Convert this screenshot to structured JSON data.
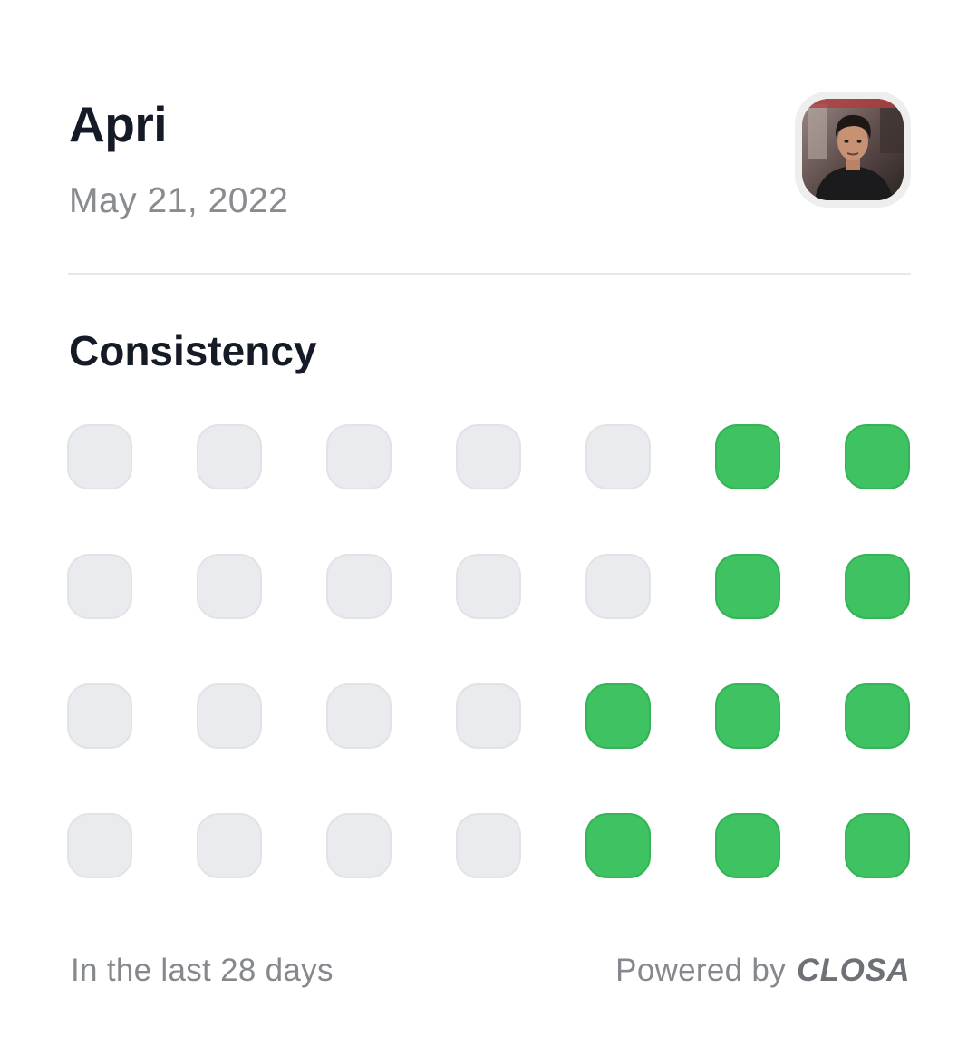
{
  "profile": {
    "name": "Apri",
    "date": "May 21, 2022",
    "avatar_icon": "user-photo"
  },
  "section": {
    "title": "Consistency"
  },
  "consistency": {
    "rows": [
      [
        false,
        false,
        false,
        false,
        false,
        true,
        true
      ],
      [
        false,
        false,
        false,
        false,
        false,
        true,
        true
      ],
      [
        false,
        false,
        false,
        false,
        true,
        true,
        true
      ],
      [
        false,
        false,
        false,
        false,
        true,
        true,
        true
      ]
    ],
    "active_color": "#3fc262",
    "inactive_color": "#eaebee"
  },
  "footer": {
    "period_label": "In the last 28 days",
    "powered_by_label": "Powered by",
    "brand": "CLOSA"
  }
}
